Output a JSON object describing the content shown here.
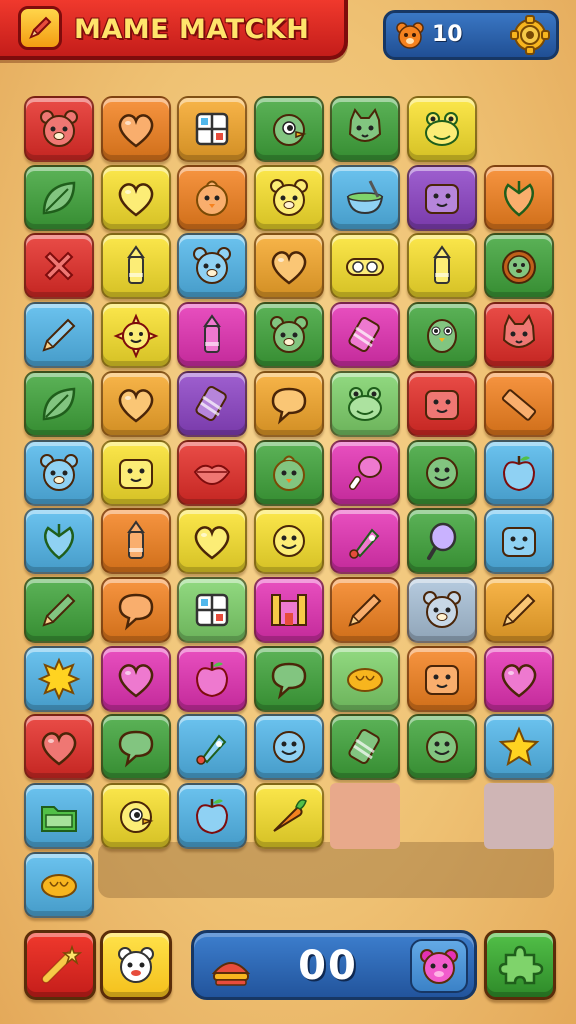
{
  "header": {
    "title": "MAME MATCKH",
    "counter_value": "10",
    "counter_icon": "bear-face-icon",
    "settings_icon": "gear-icon"
  },
  "board": {
    "columns": 7,
    "rows": 12,
    "tiles": [
      {
        "row": 0,
        "col": 0,
        "color": "#e62d28",
        "icon": "bear-face-icon"
      },
      {
        "row": 0,
        "col": 1,
        "color": "#f5821f",
        "icon": "heart-icon"
      },
      {
        "row": 0,
        "col": 2,
        "color": "#f7a82a",
        "icon": "window-icon"
      },
      {
        "row": 0,
        "col": 3,
        "color": "#3fa63b",
        "icon": "bird-icon"
      },
      {
        "row": 0,
        "col": 4,
        "color": "#3fa63b",
        "icon": "cat-icon"
      },
      {
        "row": 0,
        "col": 5,
        "color": "#fbe32c",
        "icon": "frog-icon"
      },
      {
        "row": 1,
        "col": 0,
        "color": "#3fa63b",
        "icon": "leaf-icon"
      },
      {
        "row": 1,
        "col": 1,
        "color": "#fbe32c",
        "icon": "heart-icon"
      },
      {
        "row": 1,
        "col": 2,
        "color": "#f5821f",
        "icon": "chick-icon"
      },
      {
        "row": 1,
        "col": 3,
        "color": "#fbe32c",
        "icon": "bear-face-icon"
      },
      {
        "row": 1,
        "col": 4,
        "color": "#52b8ec",
        "icon": "bowl-icon"
      },
      {
        "row": 1,
        "col": 5,
        "color": "#8e44c8",
        "icon": "block-face-icon"
      },
      {
        "row": 1,
        "col": 6,
        "color": "#f5821f",
        "icon": "leaf-heart-icon"
      },
      {
        "row": 2,
        "col": 0,
        "color": "#e62d28",
        "icon": "cross-icon"
      },
      {
        "row": 2,
        "col": 1,
        "color": "#fbe32c",
        "icon": "crayon-icon"
      },
      {
        "row": 2,
        "col": 2,
        "color": "#52b8ec",
        "icon": "bear-face-icon"
      },
      {
        "row": 2,
        "col": 3,
        "color": "#f7a82a",
        "icon": "heart-icon"
      },
      {
        "row": 2,
        "col": 4,
        "color": "#fbe32c",
        "icon": "goggles-icon"
      },
      {
        "row": 2,
        "col": 5,
        "color": "#fbe32c",
        "icon": "crayon-icon"
      },
      {
        "row": 2,
        "col": 6,
        "color": "#3fa63b",
        "icon": "lion-icon"
      },
      {
        "row": 3,
        "col": 0,
        "color": "#52b8ec",
        "icon": "pencil-icon"
      },
      {
        "row": 3,
        "col": 1,
        "color": "#fbe32c",
        "icon": "sun-face-icon"
      },
      {
        "row": 3,
        "col": 2,
        "color": "#e531b5",
        "icon": "crayon-icon"
      },
      {
        "row": 3,
        "col": 3,
        "color": "#3fa63b",
        "icon": "bear-face-icon"
      },
      {
        "row": 3,
        "col": 4,
        "color": "#e531b5",
        "icon": "candy-icon"
      },
      {
        "row": 3,
        "col": 5,
        "color": "#3fa63b",
        "icon": "owl-icon"
      },
      {
        "row": 3,
        "col": 6,
        "color": "#e62d28",
        "icon": "cat-icon"
      },
      {
        "row": 4,
        "col": 0,
        "color": "#3fa63b",
        "icon": "leaf-icon"
      },
      {
        "row": 4,
        "col": 1,
        "color": "#f7a82a",
        "icon": "heart-icon"
      },
      {
        "row": 4,
        "col": 2,
        "color": "#8e44c8",
        "icon": "candy-icon"
      },
      {
        "row": 4,
        "col": 3,
        "color": "#f7a82a",
        "icon": "speech-bubble-icon"
      },
      {
        "row": 4,
        "col": 4,
        "color": "#7fd36b",
        "icon": "frog-icon"
      },
      {
        "row": 4,
        "col": 5,
        "color": "#e62d28",
        "icon": "block-face-icon"
      },
      {
        "row": 4,
        "col": 6,
        "color": "#f5821f",
        "icon": "ruler-icon"
      },
      {
        "row": 5,
        "col": 0,
        "color": "#52b8ec",
        "icon": "bear-face-icon"
      },
      {
        "row": 5,
        "col": 1,
        "color": "#fbe32c",
        "icon": "block-face-icon"
      },
      {
        "row": 5,
        "col": 2,
        "color": "#e62d28",
        "icon": "lips-icon"
      },
      {
        "row": 5,
        "col": 3,
        "color": "#3fa63b",
        "icon": "chick-icon"
      },
      {
        "row": 5,
        "col": 4,
        "color": "#e531b5",
        "icon": "drumstick-icon"
      },
      {
        "row": 5,
        "col": 5,
        "color": "#3fa63b",
        "icon": "smiley-icon"
      },
      {
        "row": 5,
        "col": 6,
        "color": "#52b8ec",
        "icon": "apple-icon"
      },
      {
        "row": 6,
        "col": 0,
        "color": "#52b8ec",
        "icon": "leaf-heart-icon"
      },
      {
        "row": 6,
        "col": 1,
        "color": "#f5821f",
        "icon": "crayon-icon"
      },
      {
        "row": 6,
        "col": 2,
        "color": "#fbe32c",
        "icon": "heart-icon"
      },
      {
        "row": 6,
        "col": 3,
        "color": "#fbe32c",
        "icon": "smiley-icon"
      },
      {
        "row": 6,
        "col": 4,
        "color": "#e531b5",
        "icon": "rocket-icon"
      },
      {
        "row": 6,
        "col": 5,
        "color": "#3fa63b",
        "icon": "mirror-icon"
      },
      {
        "row": 6,
        "col": 6,
        "color": "#52b8ec",
        "icon": "block-face-icon"
      },
      {
        "row": 7,
        "col": 0,
        "color": "#3fa63b",
        "icon": "pencil-icon"
      },
      {
        "row": 7,
        "col": 1,
        "color": "#f5821f",
        "icon": "speech-bubble-icon"
      },
      {
        "row": 7,
        "col": 2,
        "color": "#7fd36b",
        "icon": "window-icon"
      },
      {
        "row": 7,
        "col": 3,
        "color": "#e531b5",
        "icon": "castle-icon"
      },
      {
        "row": 7,
        "col": 4,
        "color": "#f5821f",
        "icon": "pencil-icon"
      },
      {
        "row": 7,
        "col": 5,
        "color": "#a9c2d9",
        "icon": "bear-face-icon"
      },
      {
        "row": 7,
        "col": 6,
        "color": "#f7a82a",
        "icon": "pencil-icon"
      },
      {
        "row": 8,
        "col": 0,
        "color": "#52b8ec",
        "icon": "sun-icon"
      },
      {
        "row": 8,
        "col": 1,
        "color": "#e531b5",
        "icon": "heart-icon"
      },
      {
        "row": 8,
        "col": 2,
        "color": "#e531b5",
        "icon": "apple-icon"
      },
      {
        "row": 8,
        "col": 3,
        "color": "#3fa63b",
        "icon": "speech-bubble-icon"
      },
      {
        "row": 8,
        "col": 4,
        "color": "#7fd36b",
        "icon": "bread-icon"
      },
      {
        "row": 8,
        "col": 5,
        "color": "#f5821f",
        "icon": "block-face-icon"
      },
      {
        "row": 8,
        "col": 6,
        "color": "#e531b5",
        "icon": "heart-icon"
      },
      {
        "row": 9,
        "col": 0,
        "color": "#e62d28",
        "icon": "heart-icon"
      },
      {
        "row": 9,
        "col": 1,
        "color": "#3fa63b",
        "icon": "speech-bubble-icon"
      },
      {
        "row": 9,
        "col": 2,
        "color": "#52b8ec",
        "icon": "rocket-icon"
      },
      {
        "row": 9,
        "col": 3,
        "color": "#52b8ec",
        "icon": "smiley-icon"
      },
      {
        "row": 9,
        "col": 4,
        "color": "#3fa63b",
        "icon": "candy-icon"
      },
      {
        "row": 9,
        "col": 5,
        "color": "#3fa63b",
        "icon": "smiley-icon"
      },
      {
        "row": 9,
        "col": 6,
        "color": "#52b8ec",
        "icon": "star-icon"
      },
      {
        "row": 10,
        "col": 0,
        "color": "#52b8ec",
        "icon": "folder-icon"
      },
      {
        "row": 10,
        "col": 1,
        "color": "#fbe32c",
        "icon": "bird-icon"
      },
      {
        "row": 10,
        "col": 2,
        "color": "#52b8ec",
        "icon": "apple-icon"
      },
      {
        "row": 10,
        "col": 3,
        "color": "#fbe32c",
        "icon": "carrot-icon"
      },
      {
        "row": 11,
        "col": 0,
        "color": "#52b8ec",
        "icon": "bread-icon"
      }
    ],
    "empty_slots": [
      {
        "row": 10,
        "col": 4,
        "color": "#e8a98b"
      },
      {
        "row": 10,
        "col": 6,
        "color": "#cfb5b5"
      }
    ]
  },
  "footer": {
    "shuffle_icon": "magic-wand-icon",
    "hint_icon": "ghost-face-icon",
    "score": "00",
    "score_left_icon": "cake-icon",
    "score_right_icon": "bear-face-icon",
    "puzzle_icon": "puzzle-piece-icon"
  }
}
